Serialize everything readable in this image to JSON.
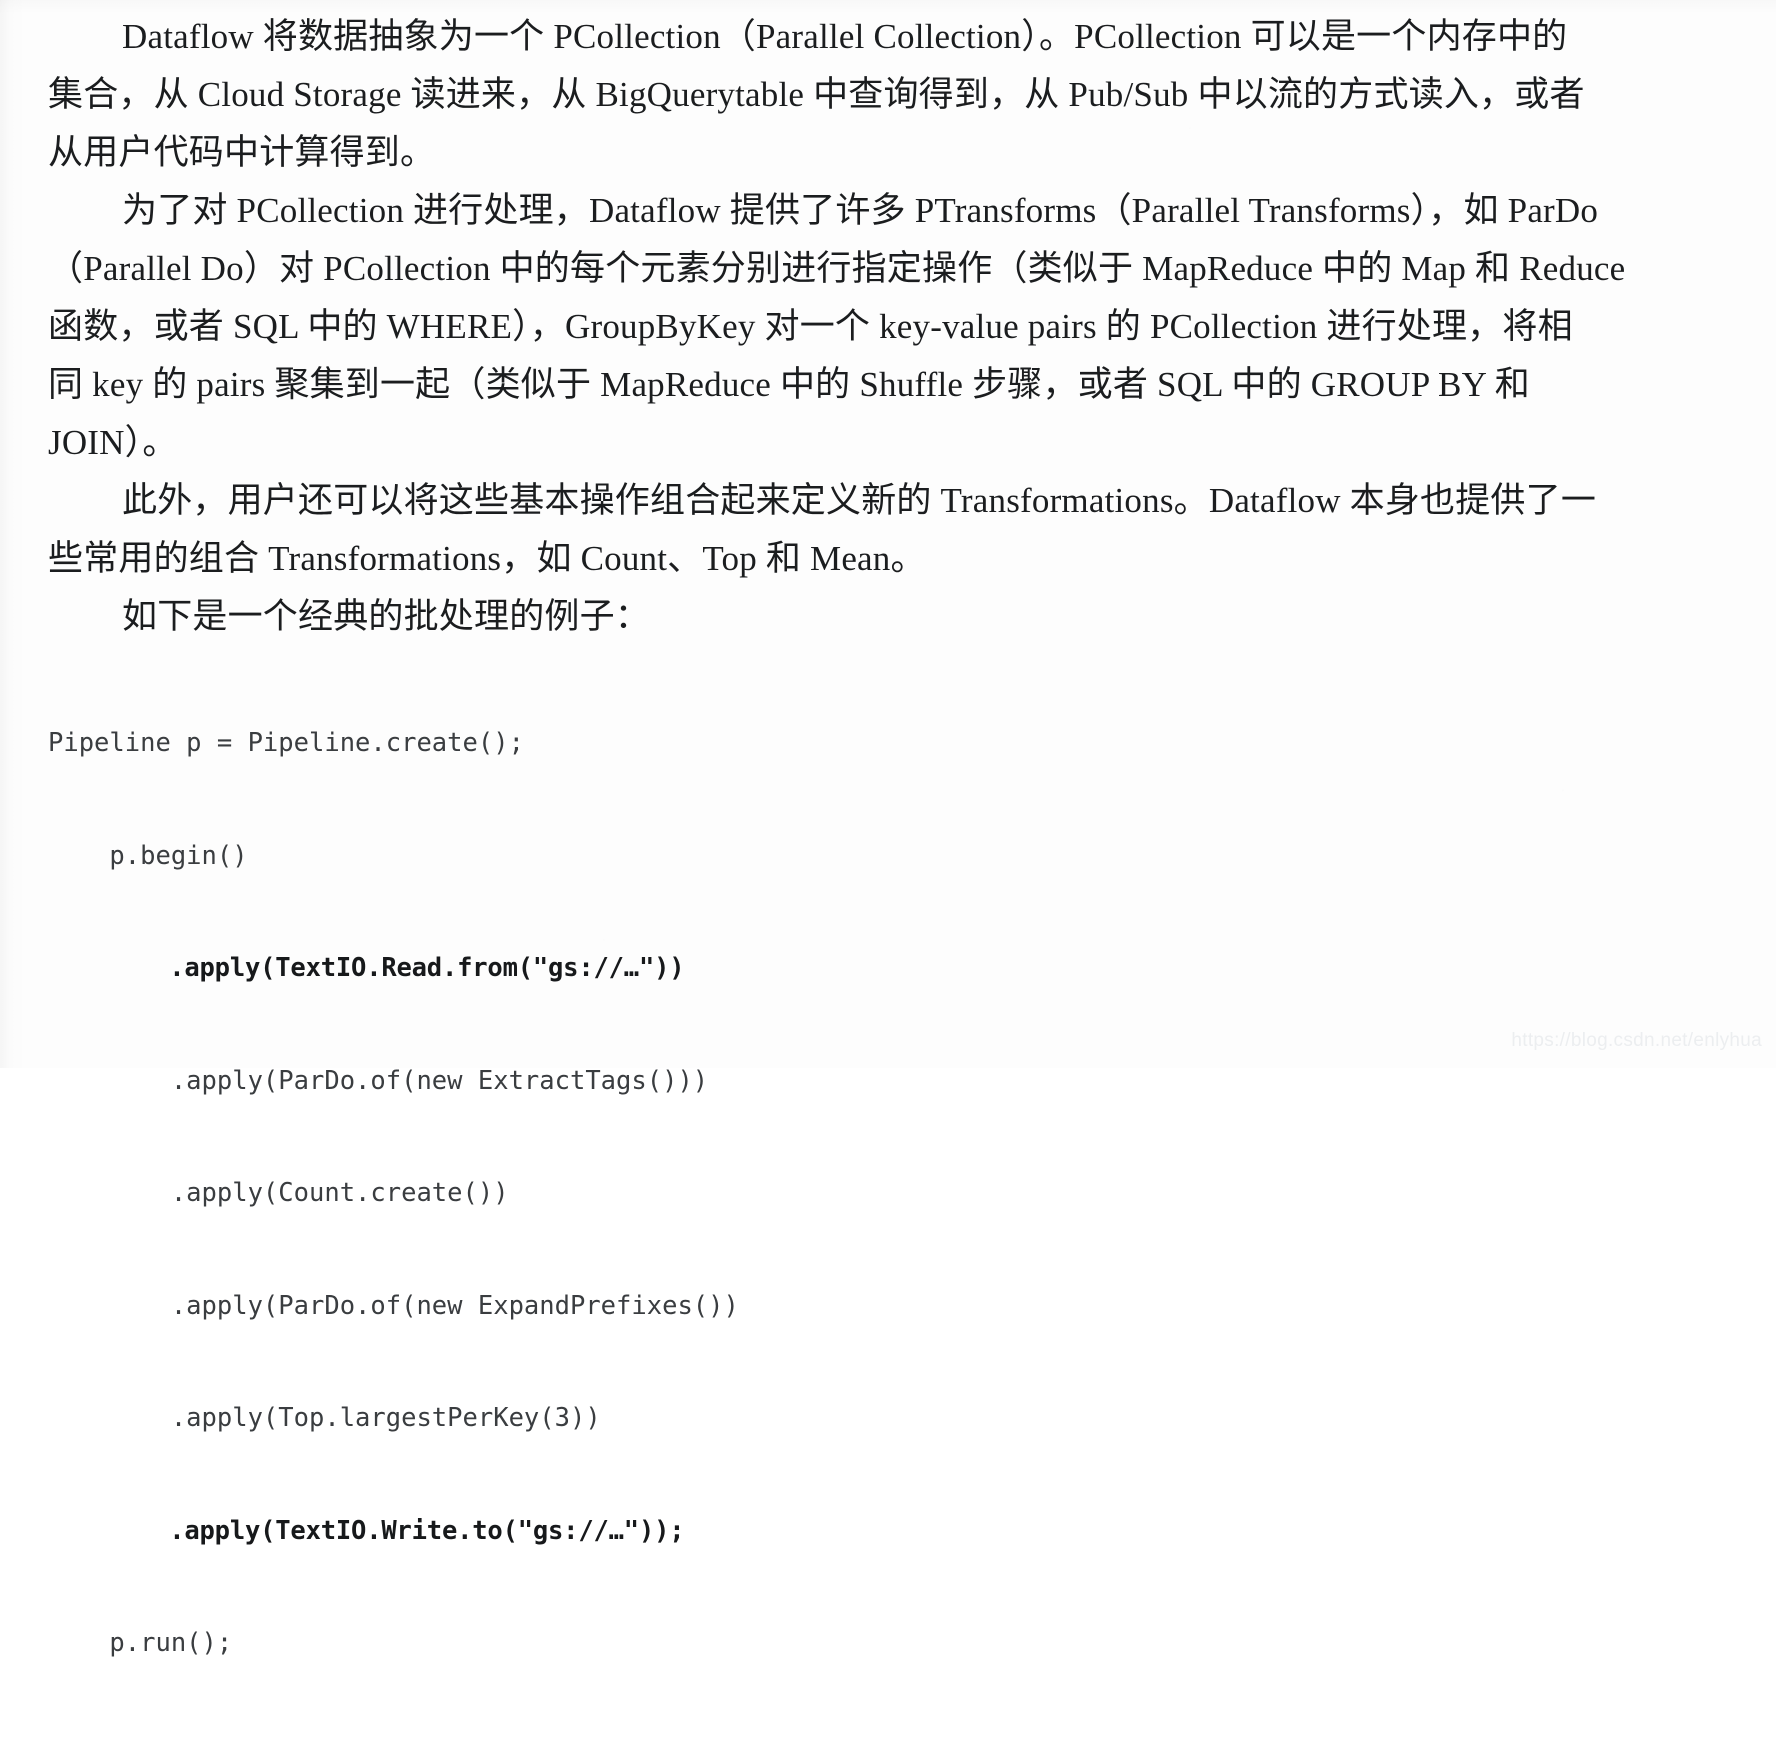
{
  "document": {
    "type": "scanned-book-page",
    "language": "zh-CN",
    "topic": "Google Cloud Dataflow PCollection / PTransforms"
  },
  "paragraphs": [
    {
      "id": "p1",
      "lines": [
        "Dataflow 将数据抽象为一个 PCollection（Parallel Collection）。PCollection 可以是一个内存中的",
        "集合，从 Cloud Storage 读进来，从 BigQuerytable 中查询得到，从 Pub/Sub 中以流的方式读入，或者",
        "从用户代码中计算得到。"
      ]
    },
    {
      "id": "p2",
      "lines": [
        "为了对 PCollection 进行处理，Dataflow 提供了许多 PTransforms（Parallel Transforms），如 ParDo",
        "（Parallel Do）对 PCollection 中的每个元素分别进行指定操作（类似于 MapReduce 中的 Map 和 Reduce",
        "函数，或者 SQL 中的 WHERE），GroupByKey 对一个 key-value pairs 的 PCollection 进行处理，将相",
        "同 key 的 pairs 聚集到一起（类似于 MapReduce 中的 Shuffle 步骤，或者 SQL 中的 GROUP BY 和",
        "JOIN）。"
      ]
    },
    {
      "id": "p3",
      "lines": [
        "此外，用户还可以将这些基本操作组合起来定义新的 Transformations。Dataflow 本身也提供了一",
        "些常用的组合 Transformations，如 Count、Top 和 Mean。"
      ]
    },
    {
      "id": "p4",
      "lines": [
        "如下是一个经典的批处理的例子："
      ]
    }
  ],
  "code_block": {
    "language": "java",
    "lines": [
      {
        "text": "Pipeline p = Pipeline.create();",
        "bold": false
      },
      {
        "text": "    p.begin()",
        "bold": false
      },
      {
        "text": "        .apply(TextIO.Read.from(\"gs://…\"))",
        "bold": true
      },
      {
        "text": "        .apply(ParDo.of(new ExtractTags()))",
        "bold": false
      },
      {
        "text": "        .apply(Count.create())",
        "bold": false
      },
      {
        "text": "        .apply(ParDo.of(new ExpandPrefixes())",
        "bold": false
      },
      {
        "text": "        .apply(Top.largestPerKey(3))",
        "bold": false
      },
      {
        "text": "        .apply(TextIO.Write.to(\"gs://…\"));",
        "bold": true
      },
      {
        "text": "    p.run();",
        "bold": false
      }
    ]
  },
  "watermark": {
    "text": "https://blog.csdn.net/enlyhua",
    "color": "#eceef0"
  }
}
